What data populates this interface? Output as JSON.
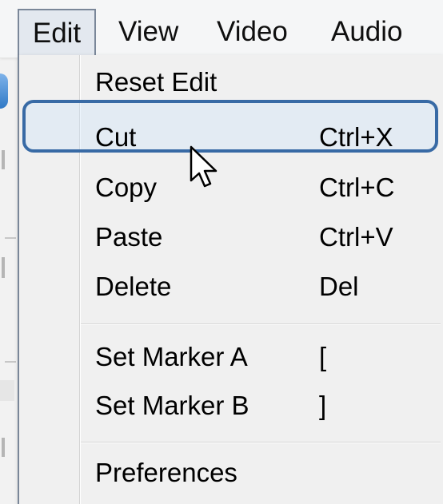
{
  "menubar": {
    "items": [
      {
        "label": "Edit",
        "active": true
      },
      {
        "label": "View"
      },
      {
        "label": "Video"
      },
      {
        "label": "Audio"
      }
    ]
  },
  "dropdown": {
    "items": [
      {
        "label": "Reset Edit",
        "shortcut": ""
      },
      {
        "label": "Cut",
        "shortcut": "Ctrl+X",
        "highlighted": true
      },
      {
        "label": "Copy",
        "shortcut": "Ctrl+C"
      },
      {
        "label": "Paste",
        "shortcut": "Ctrl+V"
      },
      {
        "label": "Delete",
        "shortcut": "Del"
      },
      {
        "label": "Set Marker A",
        "shortcut": "["
      },
      {
        "label": "Set Marker B",
        "shortcut": "]"
      },
      {
        "label": "Preferences",
        "shortcut": ""
      }
    ]
  },
  "colors": {
    "highlight_border": "#386aa5",
    "menu_background": "#f0f0f0",
    "active_menu_background": "#e3e8ef"
  },
  "icons": {
    "cursor": "mouse-pointer-icon"
  }
}
